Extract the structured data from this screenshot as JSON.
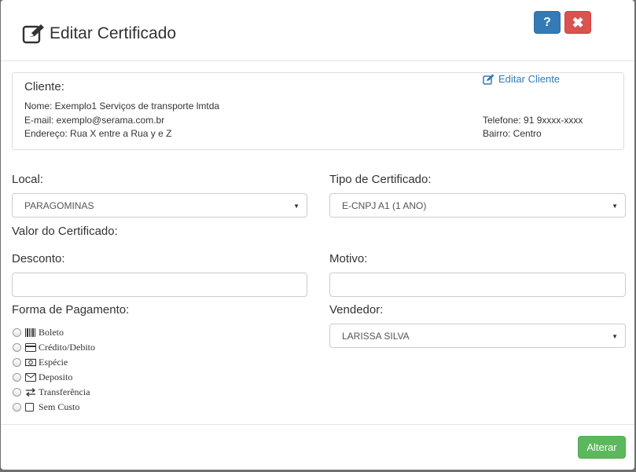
{
  "modal": {
    "title": "Editar Certificado",
    "help_label": "?",
    "close_label": "✖"
  },
  "client": {
    "heading": "Cliente:",
    "edit_link": "Editar Cliente",
    "name": "Nome: Exemplo1 Serviços de transporte lmtda",
    "email": "E-mail: exemplo@serama.com.br",
    "address": "Endereço: Rua X entre a Rua y e Z",
    "phone": "Telefone: 91 9xxxx-xxxx",
    "district": "Bairro: Centro"
  },
  "form": {
    "local_label": "Local:",
    "local_value": "PARAGOMINAS",
    "tipo_label": "Tipo de Certificado:",
    "tipo_value": "E-CNPJ A1 (1 ANO)",
    "valor_label": "Valor do Certificado:",
    "desconto_label": "Desconto:",
    "desconto_value": "",
    "motivo_label": "Motivo:",
    "motivo_value": "",
    "pagamento_label": "Forma de Pagamento:",
    "vendedor_label": "Vendedor:",
    "vendedor_value": "LARISSA SILVA",
    "payment_options": [
      {
        "label": "Boleto",
        "icon": "barcode-icon"
      },
      {
        "label": "Crédito/Debito",
        "icon": "credit-card-icon"
      },
      {
        "label": "Espécie",
        "icon": "money-icon"
      },
      {
        "label": "Deposito",
        "icon": "envelope-icon"
      },
      {
        "label": "Transferência",
        "icon": "exchange-icon"
      },
      {
        "label": "Sem Custo",
        "icon": "square-icon"
      }
    ]
  },
  "footer": {
    "submit_label": "Alterar"
  },
  "colors": {
    "primary": "#337ab7",
    "danger": "#d9534f",
    "success": "#5cb85c"
  }
}
